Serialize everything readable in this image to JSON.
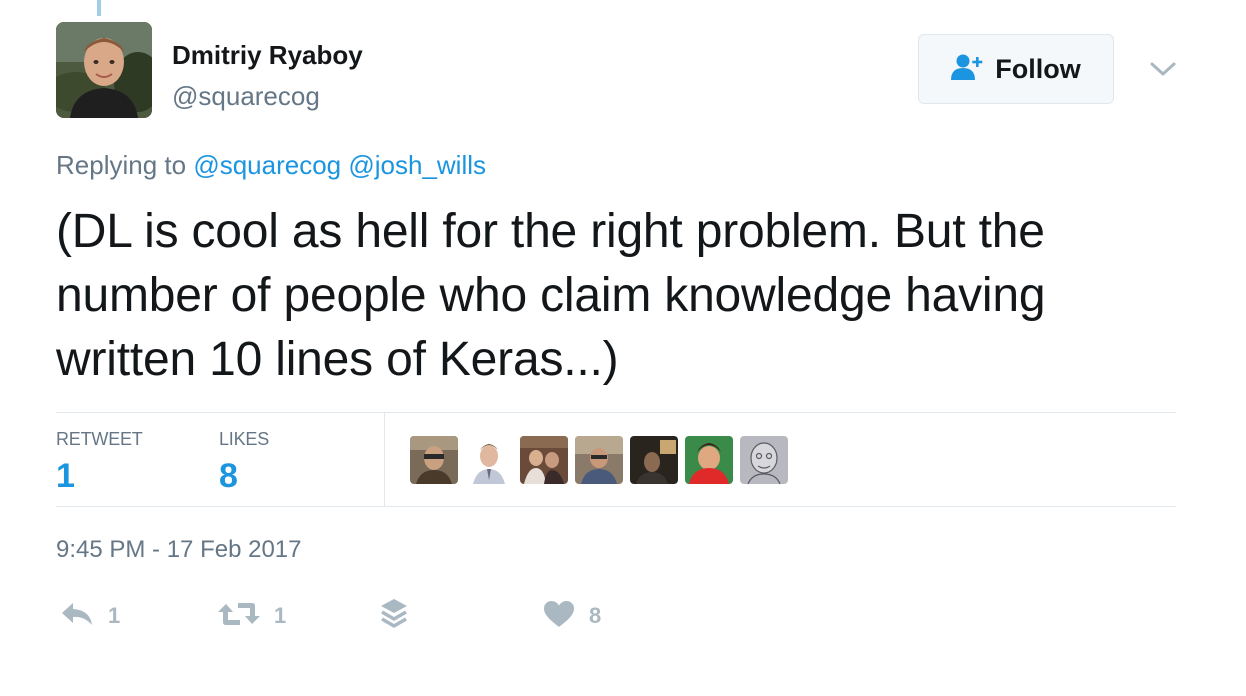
{
  "author": {
    "name": "Dmitriy Ryaboy",
    "handle": "@squarecog"
  },
  "follow_button": {
    "label": "Follow",
    "icon": "follow-user-icon"
  },
  "reply_context": {
    "prefix": "Replying to",
    "mentions": [
      "@squarecog",
      "@josh_wills"
    ]
  },
  "tweet": {
    "text": "(DL is cool as hell for the right problem.  But the\nnumber of people who claim knowledge having\nwritten 10 lines of Keras...)"
  },
  "stats": {
    "retweet_label": "RETWEET",
    "retweet_count": "1",
    "likes_label": "LIKES",
    "likes_count": "8"
  },
  "timestamp": "9:45 PM - 17 Feb 2017",
  "actions": {
    "reply_count": "1",
    "retweet_count": "1",
    "like_count": "8",
    "icons": [
      "reply-icon",
      "retweet-icon",
      "stack-icon",
      "heart-icon"
    ]
  },
  "colors": {
    "link": "#1b95e0",
    "muted": "#657786",
    "action_gray": "#aab8c2",
    "text": "#14171a",
    "border": "#e1e8ed"
  }
}
